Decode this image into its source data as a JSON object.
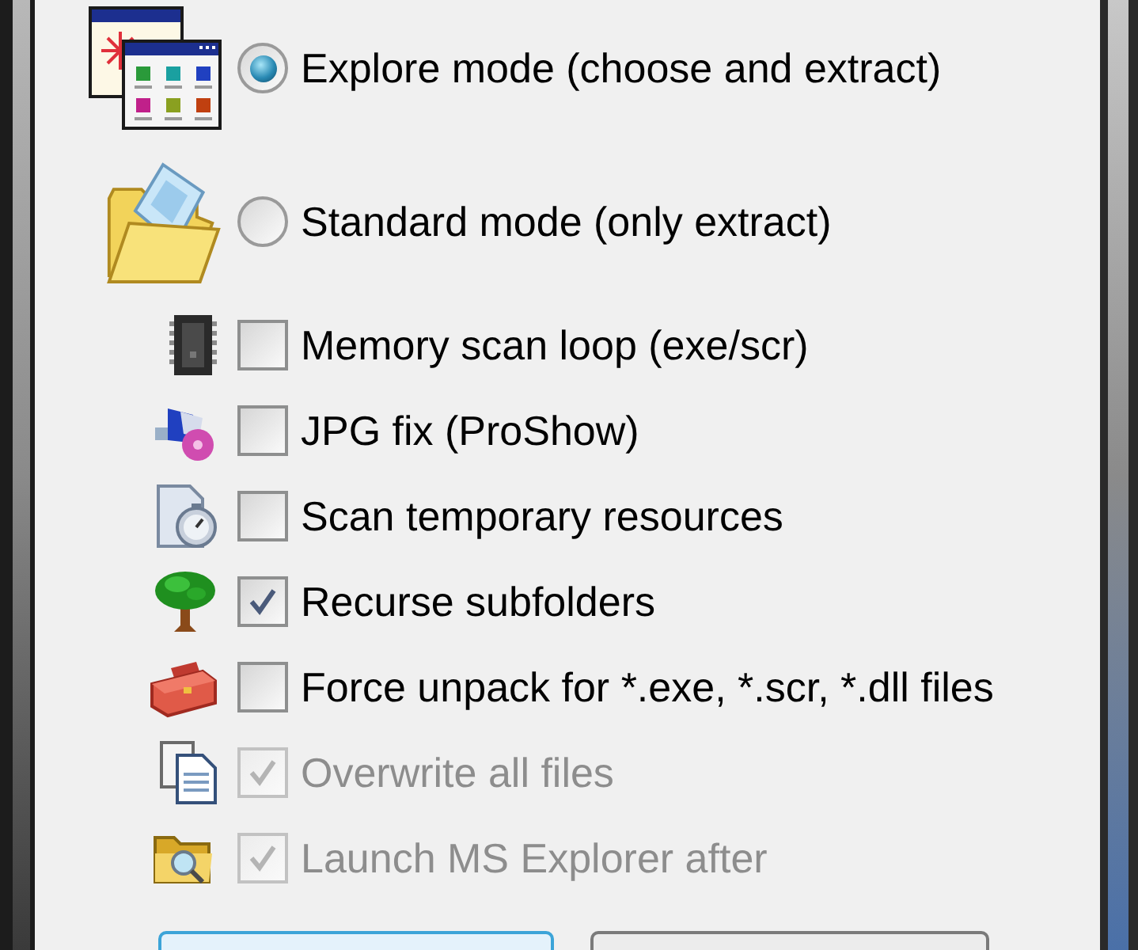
{
  "modes": [
    {
      "label": "Explore mode (choose and extract)",
      "selected": true
    },
    {
      "label": "Standard mode (only extract)",
      "selected": false
    }
  ],
  "options": [
    {
      "label": "Memory scan loop (exe/scr)",
      "checked": false,
      "disabled": false
    },
    {
      "label": "JPG fix (ProShow)",
      "checked": false,
      "disabled": false
    },
    {
      "label": "Scan temporary resources",
      "checked": false,
      "disabled": false
    },
    {
      "label": "Recurse subfolders",
      "checked": true,
      "disabled": false
    },
    {
      "label": "Force unpack for *.exe, *.scr, *.dll files",
      "checked": false,
      "disabled": false
    },
    {
      "label": "Overwrite all files",
      "checked": true,
      "disabled": true
    },
    {
      "label": "Launch MS Explorer after",
      "checked": true,
      "disabled": true
    }
  ],
  "buttons": [
    {
      "default": true
    },
    {
      "default": false
    }
  ]
}
